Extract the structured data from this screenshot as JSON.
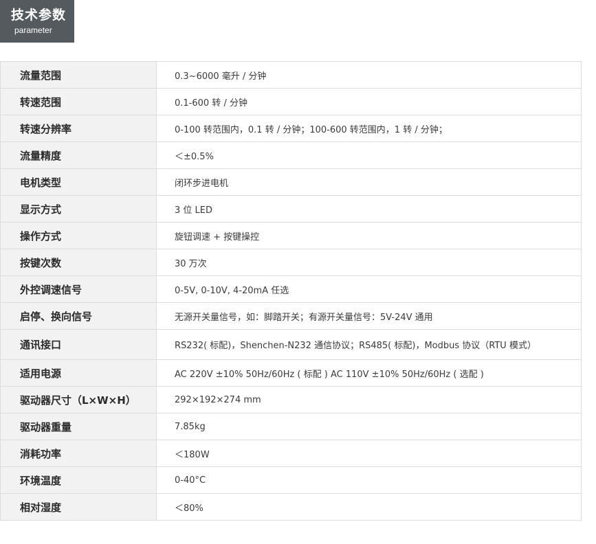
{
  "header": {
    "title": "技术参数",
    "subtitle": "parameter"
  },
  "params": [
    {
      "label": "流量范围",
      "value": "0.3~6000 毫升 / 分钟"
    },
    {
      "label": "转速范围",
      "value": "0.1-600 转 / 分钟"
    },
    {
      "label": "转速分辨率",
      "value": "0-100 转范围内，0.1 转 / 分钟；100-600 转范围内，1 转 / 分钟；"
    },
    {
      "label": "流量精度",
      "value": "＜±0.5%"
    },
    {
      "label": "电机类型",
      "value": "闭环步进电机"
    },
    {
      "label": "显示方式",
      "value": "3 位 LED"
    },
    {
      "label": "操作方式",
      "value": "旋钮调速 + 按键操控"
    },
    {
      "label": "按键次数",
      "value": "30 万次"
    },
    {
      "label": "外控调速信号",
      "value": "0-5V, 0-10V, 4-20mA 任选"
    },
    {
      "label": "启停、换向信号",
      "value": "无源开关量信号，如：脚踏开关；有源开关量信号：5V-24V 通用"
    },
    {
      "label": "通讯接口",
      "value": "RS232( 标配)，Shenchen-N232 通信协议；RS485( 标配)，Modbus 协议（RTU 模式）"
    },
    {
      "label": "适用电源",
      "value": "AC  220V ±10% 50Hz/60Hz ( 标配 )  AC  110V ±10% 50Hz/60Hz ( 选配 )"
    },
    {
      "label": "驱动器尺寸（L×W×H）",
      "value": "292×192×274 mm"
    },
    {
      "label": "驱动器重量",
      "value": "7.85kg"
    },
    {
      "label": "消耗功率",
      "value": "＜180W"
    },
    {
      "label": "环境温度",
      "value": " 0-40°C"
    },
    {
      "label": "相对湿度",
      "value": "＜80%"
    }
  ]
}
